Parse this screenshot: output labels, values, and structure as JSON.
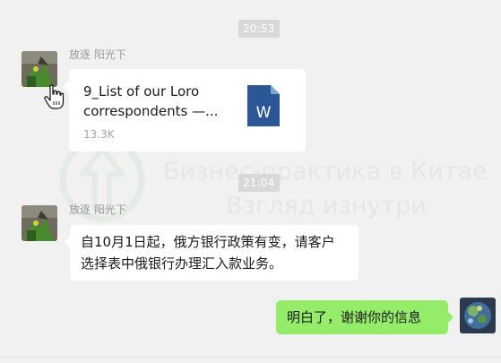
{
  "chat": {
    "timestamps": [
      "20:53",
      "21:04"
    ],
    "contact_name": "放逐  阳光下",
    "messages": {
      "file": {
        "name": "9_List of our Loro correspondents —...",
        "size": "13.3K",
        "icon": "word-doc-icon",
        "icon_letter": "W"
      },
      "text_in": "自10月1日起，俄方银行政策有变，请客户选择表中俄银行办理汇入款业务。",
      "text_out": "明白了，谢谢你的信息"
    }
  },
  "watermark": {
    "line1": "Бизнес-практика в Китае",
    "line2": "Взгляд изнутри"
  },
  "colors": {
    "background": "#f1f1f1",
    "bubble_in": "#ffffff",
    "bubble_out": "#95ec69",
    "word_blue": "#2b5797",
    "timestamp_chip": "#d8d8d8"
  }
}
